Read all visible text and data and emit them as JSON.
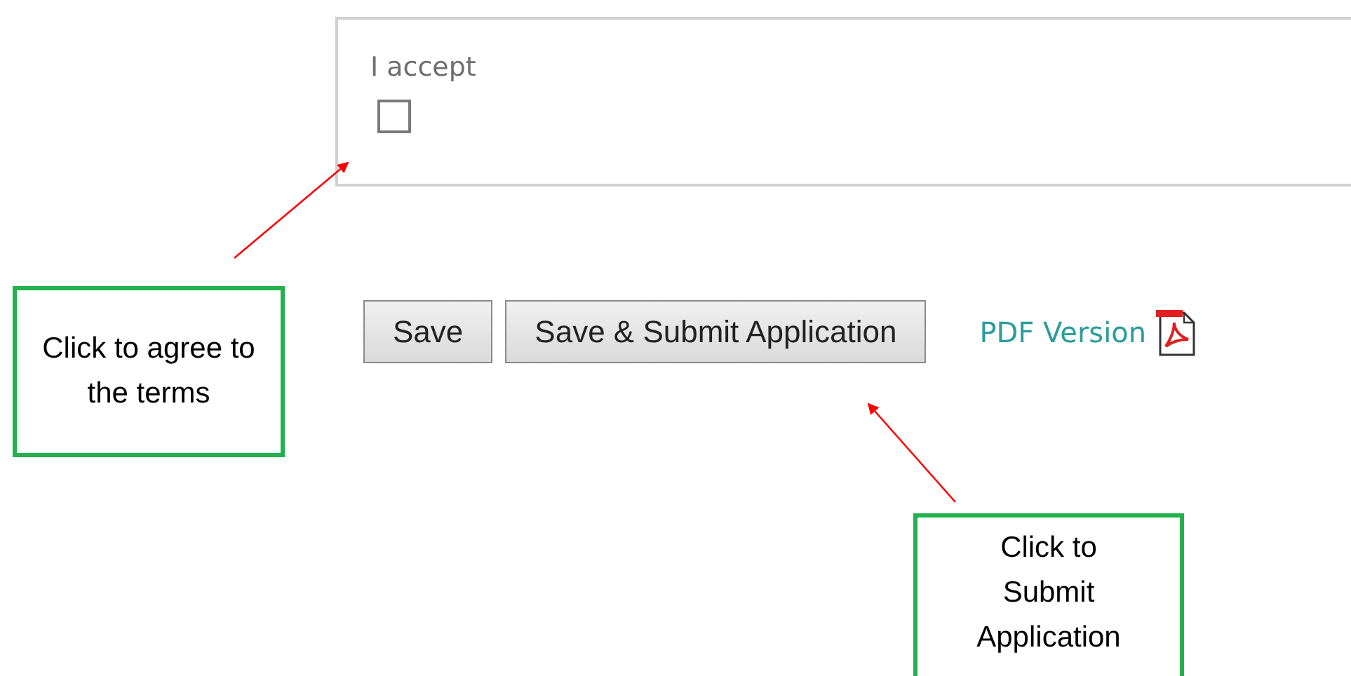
{
  "terms": {
    "label": "I accept",
    "checked": false
  },
  "buttons": [
    "Save",
    "Save & Submit Application"
  ],
  "pdf_link": {
    "label": "PDF Version"
  },
  "callouts": [
    {
      "text": "Click to agree to the terms"
    },
    {
      "text": "Click to Submit Application"
    }
  ]
}
